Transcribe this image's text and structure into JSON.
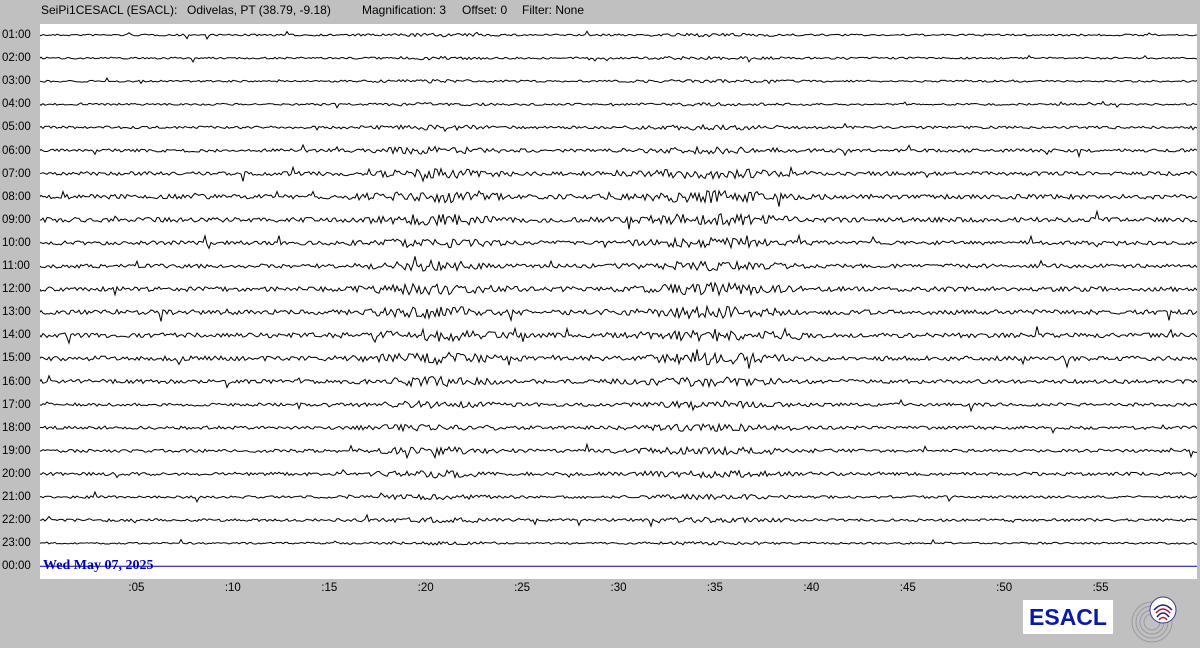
{
  "header": {
    "station": "SeiPi1CESACL (ESACL):",
    "location": "Odivelas, PT (38.79, -9.18)",
    "magnification": "Magnification: 3",
    "offset": "Offset: 0",
    "filter": "Filter: None"
  },
  "hours": [
    "01:00",
    "02:00",
    "03:00",
    "04:00",
    "05:00",
    "06:00",
    "07:00",
    "08:00",
    "09:00",
    "10:00",
    "11:00",
    "12:00",
    "13:00",
    "14:00",
    "15:00",
    "16:00",
    "17:00",
    "18:00",
    "19:00",
    "20:00",
    "21:00",
    "22:00",
    "23:00",
    "00:00"
  ],
  "minute_ticks": [
    ":05",
    ":10",
    ":15",
    ":20",
    ":25",
    ":30",
    ":35",
    ":40",
    ":45",
    ":50",
    ":55"
  ],
  "date_label": "Wed May 07, 2025",
  "logo": {
    "text": "ESACL",
    "seal_icon": "seismic-swirl-seal-icon"
  },
  "colors": {
    "trace": "#000000",
    "current_line": "#0000c8",
    "date": "#0000b0",
    "logo": "#0a1aa8",
    "background": "#c0c0c0"
  },
  "trace_activity": [
    1,
    1,
    1,
    1,
    2,
    3,
    4,
    5,
    5,
    4,
    4,
    5,
    5,
    5,
    5,
    4,
    3,
    3,
    3,
    3,
    2,
    2,
    1,
    0
  ]
}
